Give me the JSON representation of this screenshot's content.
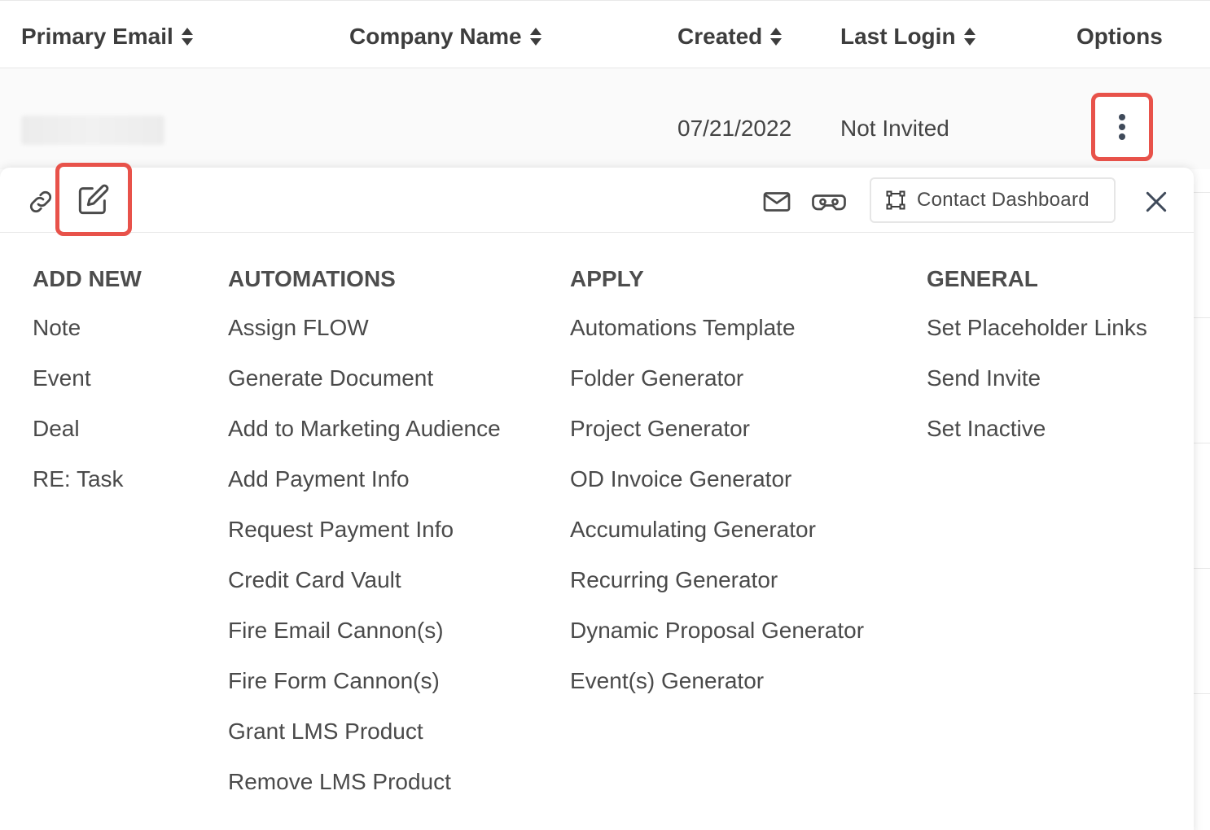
{
  "table": {
    "columns": [
      {
        "label": "Primary Email",
        "sortable": true
      },
      {
        "label": "Company Name",
        "sortable": true
      },
      {
        "label": "Created",
        "sortable": true
      },
      {
        "label": "Last Login",
        "sortable": true
      },
      {
        "label": "Options",
        "sortable": false
      }
    ],
    "row": {
      "primary_email": "",
      "company_name": "",
      "created": "07/21/2022",
      "last_login": "Not Invited"
    }
  },
  "popup": {
    "toolbar": {
      "left_icons": [
        "link-icon",
        "edit-icon"
      ],
      "right_icons": [
        "mail-icon",
        "vr-goggles-icon"
      ],
      "contact_dashboard_label": "Contact Dashboard",
      "close_icon": "close-icon"
    },
    "columns": [
      {
        "heading": "ADD NEW",
        "items": [
          "Note",
          "Event",
          "Deal",
          "RE: Task"
        ]
      },
      {
        "heading": "AUTOMATIONS",
        "items": [
          "Assign FLOW",
          "Generate Document",
          "Add to Marketing Audience",
          "Add Payment Info",
          "Request Payment Info",
          "Credit Card Vault",
          "Fire Email Cannon(s)",
          "Fire Form Cannon(s)",
          "Grant LMS Product",
          "Remove LMS Product"
        ]
      },
      {
        "heading": "APPLY",
        "items": [
          "Automations Template",
          "Folder Generator",
          "Project Generator",
          "OD Invoice Generator",
          "Accumulating Generator",
          "Recurring Generator",
          "Dynamic Proposal Generator",
          "Event(s) Generator"
        ]
      },
      {
        "heading": "GENERAL",
        "items": [
          "Set Placeholder Links",
          "Send Invite",
          "Set Inactive"
        ]
      }
    ]
  },
  "colors": {
    "highlight": "#e8524a",
    "text": "#4a4a4a",
    "header_text": "#3d3d3d",
    "icon": "#3f4a5a"
  }
}
